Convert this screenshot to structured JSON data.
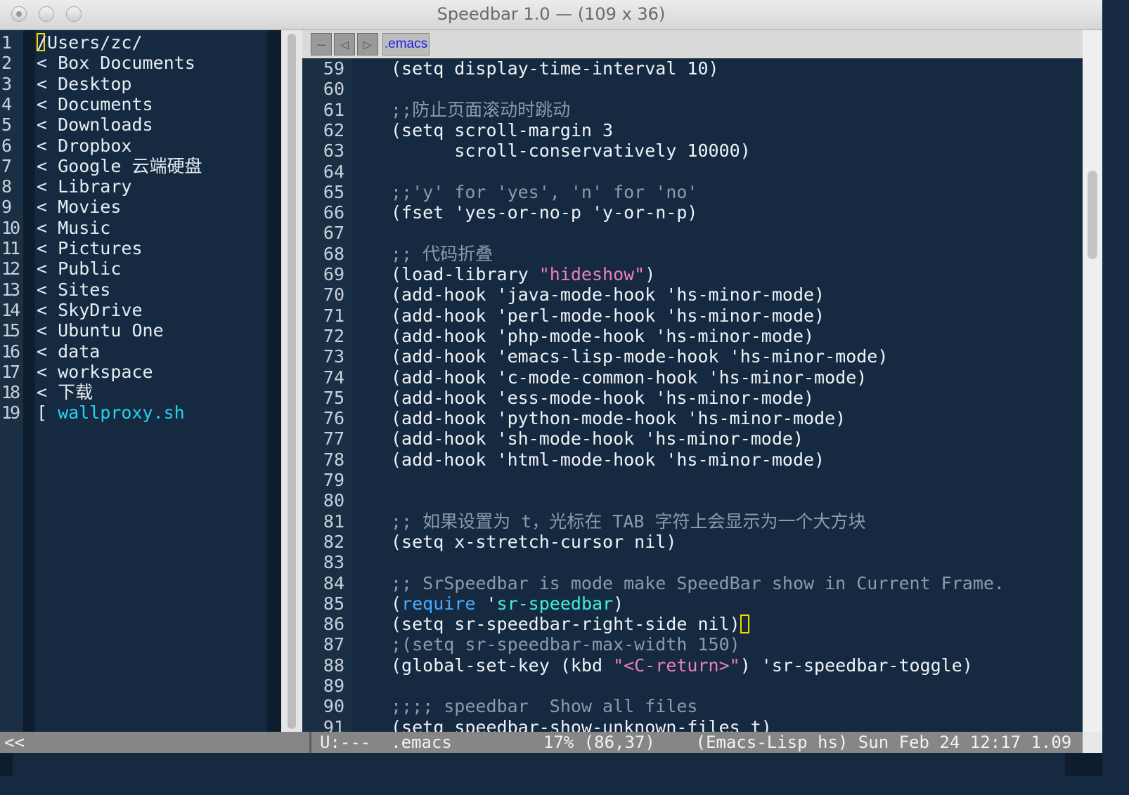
{
  "window": {
    "title": "Speedbar 1.0  —  (109 x 36)"
  },
  "speedbar": {
    "items": [
      {
        "num": "1",
        "text": "/Users/zc/",
        "kind": "dir-root"
      },
      {
        "num": "2",
        "text": "< Box Documents",
        "kind": "dir"
      },
      {
        "num": "3",
        "text": "< Desktop",
        "kind": "dir"
      },
      {
        "num": "4",
        "text": "< Documents",
        "kind": "dir"
      },
      {
        "num": "5",
        "text": "< Downloads",
        "kind": "dir"
      },
      {
        "num": "6",
        "text": "< Dropbox",
        "kind": "dir"
      },
      {
        "num": "7",
        "text": "< Google 云端硬盘",
        "kind": "dir"
      },
      {
        "num": "8",
        "text": "< Library",
        "kind": "dir"
      },
      {
        "num": "9",
        "text": "< Movies",
        "kind": "dir"
      },
      {
        "num": "10",
        "text": "< Music",
        "kind": "dir"
      },
      {
        "num": "11",
        "text": "< Pictures",
        "kind": "dir"
      },
      {
        "num": "12",
        "text": "< Public",
        "kind": "dir"
      },
      {
        "num": "13",
        "text": "< Sites",
        "kind": "dir"
      },
      {
        "num": "14",
        "text": "< SkyDrive",
        "kind": "dir"
      },
      {
        "num": "15",
        "text": "< Ubuntu One",
        "kind": "dir"
      },
      {
        "num": "16",
        "text": "< data",
        "kind": "dir"
      },
      {
        "num": "17",
        "text": "< workspace",
        "kind": "dir"
      },
      {
        "num": "18",
        "text": "< 下载",
        "kind": "dir"
      },
      {
        "num": "19",
        "text": "[ ",
        "kind": "file-prefix",
        "file": "wallproxy.sh"
      }
    ]
  },
  "tabbar": {
    "buttons": [
      "—",
      "◁",
      "▷"
    ],
    "tab_label": ".emacs"
  },
  "editor": {
    "lines": [
      {
        "n": "59",
        "parts": [
          [
            "t",
            "(setq display-time-interval 10)"
          ]
        ]
      },
      {
        "n": "60",
        "parts": []
      },
      {
        "n": "61",
        "parts": [
          [
            "c",
            ";;防止页面滚动时跳动"
          ]
        ]
      },
      {
        "n": "62",
        "parts": [
          [
            "t",
            "(setq scroll-margin 3"
          ]
        ]
      },
      {
        "n": "63",
        "parts": [
          [
            "t",
            "      scroll-conservatively 10000)"
          ]
        ]
      },
      {
        "n": "64",
        "parts": []
      },
      {
        "n": "65",
        "parts": [
          [
            "c",
            ";;'y' for 'yes', 'n' for 'no'"
          ]
        ]
      },
      {
        "n": "66",
        "parts": [
          [
            "t",
            "(fset 'yes-or-no-p 'y-or-n-p)"
          ]
        ]
      },
      {
        "n": "67",
        "parts": []
      },
      {
        "n": "68",
        "parts": [
          [
            "c",
            ";; 代码折叠"
          ]
        ]
      },
      {
        "n": "69",
        "parts": [
          [
            "t",
            "(load-library "
          ],
          [
            "s",
            "\"hideshow\""
          ],
          [
            "t",
            ")"
          ]
        ]
      },
      {
        "n": "70",
        "parts": [
          [
            "t",
            "(add-hook 'java-mode-hook 'hs-minor-mode)"
          ]
        ]
      },
      {
        "n": "71",
        "parts": [
          [
            "t",
            "(add-hook 'perl-mode-hook 'hs-minor-mode)"
          ]
        ]
      },
      {
        "n": "72",
        "parts": [
          [
            "t",
            "(add-hook 'php-mode-hook 'hs-minor-mode)"
          ]
        ]
      },
      {
        "n": "73",
        "parts": [
          [
            "t",
            "(add-hook 'emacs-lisp-mode-hook 'hs-minor-mode)"
          ]
        ]
      },
      {
        "n": "74",
        "parts": [
          [
            "t",
            "(add-hook 'c-mode-common-hook 'hs-minor-mode)"
          ]
        ]
      },
      {
        "n": "75",
        "parts": [
          [
            "t",
            "(add-hook 'ess-mode-hook 'hs-minor-mode)"
          ]
        ]
      },
      {
        "n": "76",
        "parts": [
          [
            "t",
            "(add-hook 'python-mode-hook 'hs-minor-mode)"
          ]
        ]
      },
      {
        "n": "77",
        "parts": [
          [
            "t",
            "(add-hook 'sh-mode-hook 'hs-minor-mode)"
          ]
        ]
      },
      {
        "n": "78",
        "parts": [
          [
            "t",
            "(add-hook 'html-mode-hook 'hs-minor-mode)"
          ]
        ]
      },
      {
        "n": "79",
        "parts": []
      },
      {
        "n": "80",
        "parts": []
      },
      {
        "n": "81",
        "parts": [
          [
            "c",
            ";; 如果设置为 t，光标在 TAB 字符上会显示为一个大方块"
          ]
        ]
      },
      {
        "n": "82",
        "parts": [
          [
            "t",
            "(setq x-stretch-cursor nil)"
          ]
        ]
      },
      {
        "n": "83",
        "parts": []
      },
      {
        "n": "84",
        "parts": [
          [
            "c",
            ";; SrSpeedbar is mode make SpeedBar show in Current Frame."
          ]
        ]
      },
      {
        "n": "85",
        "parts": [
          [
            "t",
            "("
          ],
          [
            "k",
            "require"
          ],
          [
            "t",
            " '"
          ],
          [
            "q",
            "sr-speedbar"
          ],
          [
            "t",
            ")"
          ]
        ]
      },
      {
        "n": "86",
        "parts": [
          [
            "t",
            "(setq sr-speedbar-right-side nil)"
          ],
          [
            "cur",
            ""
          ]
        ]
      },
      {
        "n": "87",
        "parts": [
          [
            "c",
            ";(setq sr-speedbar-max-width 150)"
          ]
        ]
      },
      {
        "n": "88",
        "parts": [
          [
            "t",
            "(global-set-key (kbd "
          ],
          [
            "s",
            "\"<C-return>\""
          ],
          [
            "t",
            ") 'sr-speedbar-toggle)"
          ]
        ]
      },
      {
        "n": "89",
        "parts": []
      },
      {
        "n": "90",
        "parts": [
          [
            "c",
            ";;;; speedbar  Show all files"
          ]
        ]
      },
      {
        "n": "91",
        "parts": [
          [
            "t",
            "(setq speedbar-show-unknown-files t)"
          ]
        ]
      }
    ]
  },
  "modeline": {
    "left": "<<",
    "text": "U:---  .emacs         17% (86,37)    (Emacs-Lisp hs) Sun Feb 24 12:17 1.09"
  },
  "colors": {
    "background": "#152a41",
    "comment": "#8e9aa6",
    "string": "#f07fb4",
    "keyword": "#4aa8ff",
    "constant": "#3ff0e0",
    "file": "#22d3f0",
    "cursor": "#ffd700"
  }
}
